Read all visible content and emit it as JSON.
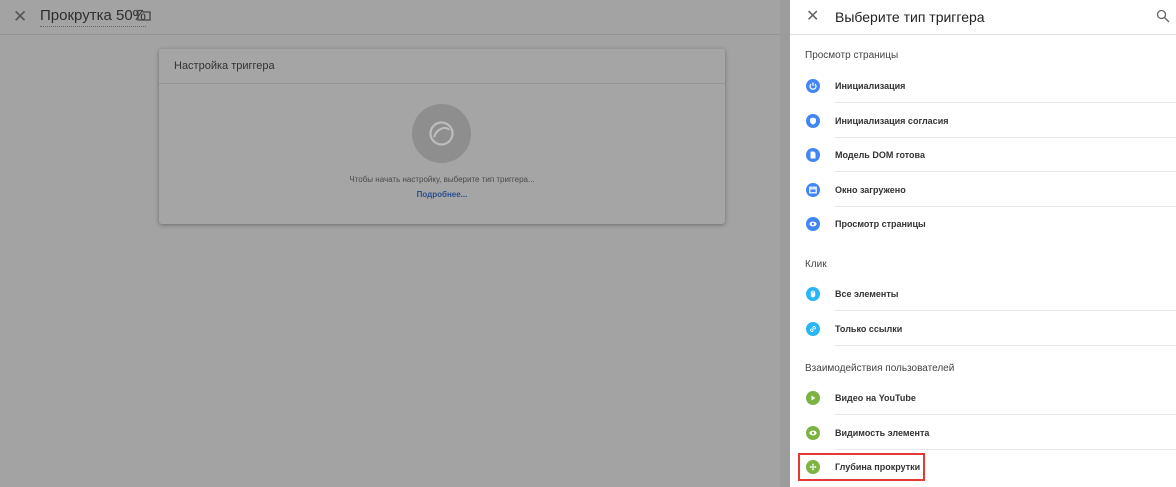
{
  "editor": {
    "title": "Прокрутка 50%",
    "card": {
      "title": "Настройка триггера",
      "hint": "Чтобы начать настройку, выберите тип триггера...",
      "link": "Подробнее..."
    }
  },
  "panel": {
    "title": "Выберите тип триггера",
    "sections": [
      {
        "title": "Просмотр страницы"
      },
      {
        "title": "Клик"
      },
      {
        "title": "Взаимодействия пользователей"
      }
    ],
    "items": [
      {
        "label": "Инициализация",
        "icon": "power-icon",
        "color": "#4285f4"
      },
      {
        "label": "Инициализация согласия",
        "icon": "shield-icon",
        "color": "#4285f4"
      },
      {
        "label": "Модель DOM готова",
        "icon": "document-icon",
        "color": "#4285f4"
      },
      {
        "label": "Окно загружено",
        "icon": "window-icon",
        "color": "#4285f4"
      },
      {
        "label": "Просмотр страницы",
        "icon": "eye-icon",
        "color": "#4285f4"
      },
      {
        "label": "Все элементы",
        "icon": "mouse-icon",
        "color": "#29b6f6"
      },
      {
        "label": "Только ссылки",
        "icon": "link-icon",
        "color": "#29b6f6"
      },
      {
        "label": "Видео на YouTube",
        "icon": "play-icon",
        "color": "#7cb342"
      },
      {
        "label": "Видимость элемента",
        "icon": "eye-icon",
        "color": "#7cb342"
      },
      {
        "label": "Глубина прокрутки",
        "icon": "move-icon",
        "color": "#7cb342"
      }
    ]
  }
}
